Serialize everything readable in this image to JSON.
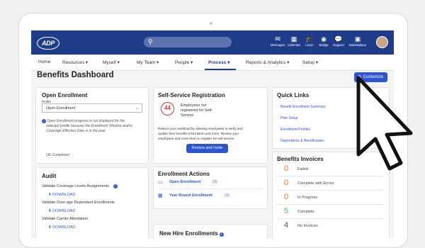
{
  "topbar": {
    "logo": "ADP",
    "icons": [
      {
        "name": "messages-icon",
        "glyph": "✉",
        "label": "Messages"
      },
      {
        "name": "calendar-icon",
        "glyph": "▦",
        "label": "Calendar"
      },
      {
        "name": "learn-icon",
        "glyph": "🎓",
        "label": "Learn"
      },
      {
        "name": "bridge-icon",
        "glyph": "◉",
        "label": "Bridge"
      },
      {
        "name": "support-icon",
        "glyph": "💬",
        "label": "Support"
      },
      {
        "name": "marketplace-icon",
        "glyph": "▣",
        "label": "Marketplace"
      }
    ]
  },
  "menu": [
    "Home",
    "Resources ▾",
    "Myself ▾",
    "My Team ▾",
    "People ▾",
    "Process ▾",
    "Reports & Analytics ▾",
    "Setup ▾"
  ],
  "page": {
    "title": "Benefits Dashboard",
    "customize": "✎ Customize"
  },
  "open_enrollment": {
    "title": "Open Enrollment",
    "profile_label": "Profile",
    "profile_value": "Open Enrollment",
    "note_lines": [
      "Open Enrollment progress is not displayed for the",
      "selected profile because the Enrollment Window and/or",
      "Coverage Effective Date is in the past."
    ],
    "status": "OE Completed"
  },
  "audit": {
    "title": "Audit",
    "items": [
      {
        "label": "Validate Coverage Levels Assignments",
        "download": "⬇ DOWNLOAD"
      },
      {
        "label": "Validate Over-age Dependent Enrollments",
        "download": "⬇ DOWNLOAD"
      },
      {
        "label": "Validate Carrier Attestation",
        "download": "⬇ DOWNLOAD"
      }
    ]
  },
  "self_service": {
    "title": "Self-Service Registration",
    "count": "44",
    "count_text": [
      "Employees not",
      "registered for Self-",
      "Service"
    ],
    "desc": [
      "Reduce your workload by allowing employees to verify and",
      "update their benefits information and more. Review your",
      "employees and invite them to register for self-service."
    ],
    "button": "Review and Invite"
  },
  "enrollment_actions": {
    "title": "Enrollment Actions",
    "items": [
      {
        "label": "Open Enrollment",
        "count": "(2)"
      },
      {
        "label": "Year Round Enrollment",
        "count": "(1)"
      }
    ]
  },
  "new_hire": {
    "title": "New Hire Enrollments"
  },
  "quick_links": {
    "title": "Quick Links",
    "items": [
      "Benefit Enrollment Summary",
      "Plan Setup",
      "Enrollment Profiles",
      "Dependents & Beneficiaries"
    ]
  },
  "invoices": {
    "title": "Benefits Invoices",
    "items": [
      {
        "num": "0",
        "label": "Failed",
        "color": "#e8752a"
      },
      {
        "num": "0",
        "label": "Complete with Errors",
        "color": "#e8752a"
      },
      {
        "num": "0",
        "label": "In Progress",
        "color": "#e8752a"
      },
      {
        "num": "5",
        "label": "Complete",
        "color": "#5cb85c"
      },
      {
        "num": "4",
        "label": "No Invoices",
        "color": "#555555"
      }
    ]
  },
  "colors": {
    "brand": "#1f3c88",
    "accent": "#2f55c8",
    "alert": "#d32f2f"
  }
}
